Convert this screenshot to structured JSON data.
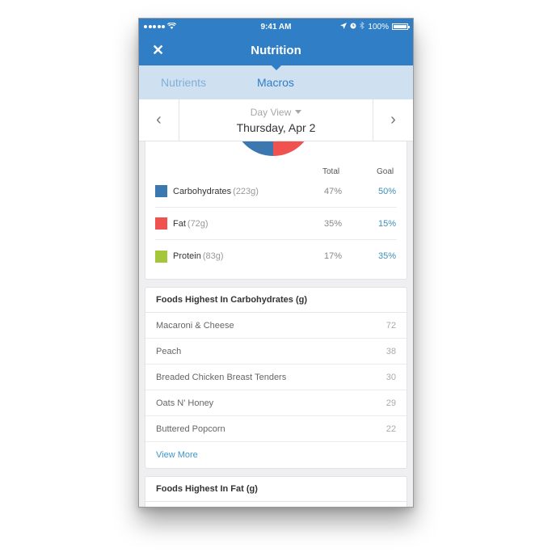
{
  "status_bar": {
    "signal": "●●●●●",
    "wifi_icon": "wifi-icon",
    "time": "9:41 AM",
    "location_icon": "location-arrow-icon",
    "alarm_icon": "alarm-icon",
    "bluetooth_icon": "bluetooth-icon",
    "battery": "100%"
  },
  "nav": {
    "close_icon": "✕",
    "title": "Nutrition"
  },
  "tabs": [
    {
      "label": "Nutrients",
      "active": false
    },
    {
      "label": "Macros",
      "active": true
    }
  ],
  "date_nav": {
    "prev_icon": "‹",
    "next_icon": "›",
    "view_label": "Day View",
    "date_label": "Thursday, Apr 2"
  },
  "macros": {
    "header_total": "Total",
    "header_goal": "Goal",
    "rows": [
      {
        "name": "Carbohydrates",
        "grams": "(223g)",
        "total": "47%",
        "goal": "50%",
        "color": "#3b78b0",
        "total_pct": 47
      },
      {
        "name": "Fat",
        "grams": "(72g)",
        "total": "35%",
        "goal": "15%",
        "color": "#f0524f",
        "total_pct": 35
      },
      {
        "name": "Protein",
        "grams": "(83g)",
        "total": "17%",
        "goal": "35%",
        "color": "#a4c63a",
        "total_pct": 17
      }
    ]
  },
  "foods_carbs": {
    "title": "Foods Highest In Carbohydrates (g)",
    "items": [
      {
        "name": "Macaroni & Cheese",
        "value": "72"
      },
      {
        "name": "Peach",
        "value": "38"
      },
      {
        "name": "Breaded Chicken Breast Tenders",
        "value": "30"
      },
      {
        "name": "Oats N' Honey",
        "value": "29"
      },
      {
        "name": "Buttered Popcorn",
        "value": "22"
      }
    ],
    "view_more": "View More"
  },
  "foods_fat": {
    "title": "Foods Highest In Fat (g)"
  },
  "colors": {
    "brand_blue": "#2f7ec6",
    "tab_bar": "#cfe0f0",
    "link": "#3f95c9"
  }
}
